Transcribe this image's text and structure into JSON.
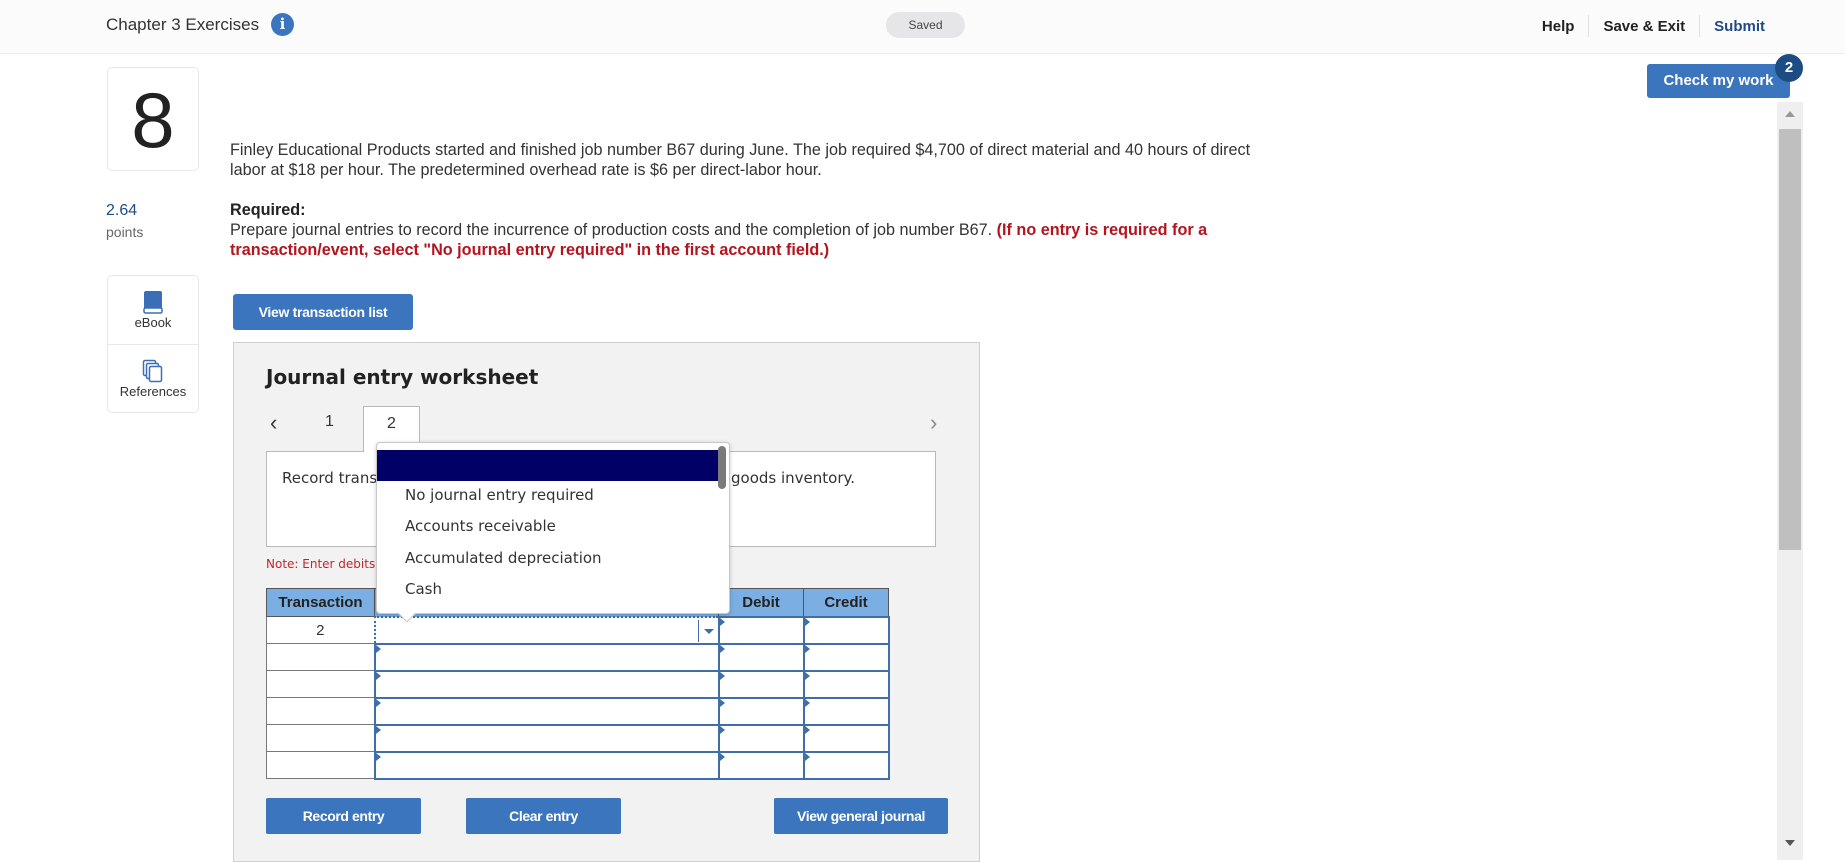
{
  "header": {
    "title": "Chapter 3 Exercises",
    "info_icon": "info-icon",
    "status": "Saved",
    "nav": {
      "help": "Help",
      "save_exit": "Save & Exit",
      "submit": "Submit"
    }
  },
  "check_work": {
    "label": "Check my work",
    "badge": "2"
  },
  "question": {
    "number": "8",
    "points_value": "2.64",
    "points_label": "points",
    "tools": [
      {
        "label": "eBook",
        "icon": "book-icon"
      },
      {
        "label": "References",
        "icon": "copy-icon"
      }
    ],
    "text": "Finley Educational Products started and finished job number B67 during June. The job required $4,700 of direct material and 40 hours of direct labor at $18 per hour. The predetermined overhead rate is $6 per direct-labor hour.",
    "required_heading": "Required:",
    "required_text": "Prepare journal entries to record the incurrence of production costs and the completion of job number B67. ",
    "required_instruction": "(If no entry is required for a transaction/event, select \"No journal entry required\" in the first account field.)"
  },
  "view_transaction_list": "View transaction list",
  "worksheet": {
    "title": "Journal entry worksheet",
    "tabs": [
      "1",
      "2"
    ],
    "active_tab": "2",
    "description_left": "Record trans",
    "description_right": "goods inventory.",
    "note": "Note: Enter debits",
    "columns": [
      "Transaction",
      "",
      "Debit",
      "Credit"
    ],
    "rows": [
      {
        "transaction": "2",
        "account": "",
        "debit": "",
        "credit": ""
      },
      {
        "transaction": "",
        "account": "",
        "debit": "",
        "credit": ""
      },
      {
        "transaction": "",
        "account": "",
        "debit": "",
        "credit": ""
      },
      {
        "transaction": "",
        "account": "",
        "debit": "",
        "credit": ""
      },
      {
        "transaction": "",
        "account": "",
        "debit": "",
        "credit": ""
      },
      {
        "transaction": "",
        "account": "",
        "debit": "",
        "credit": ""
      }
    ],
    "buttons": {
      "record": "Record entry",
      "clear": "Clear entry",
      "general_journal": "View general journal"
    }
  },
  "account_dropdown": {
    "selected": "",
    "options": [
      "No journal entry required",
      "Accounts receivable",
      "Accumulated depreciation",
      "Cash"
    ]
  }
}
